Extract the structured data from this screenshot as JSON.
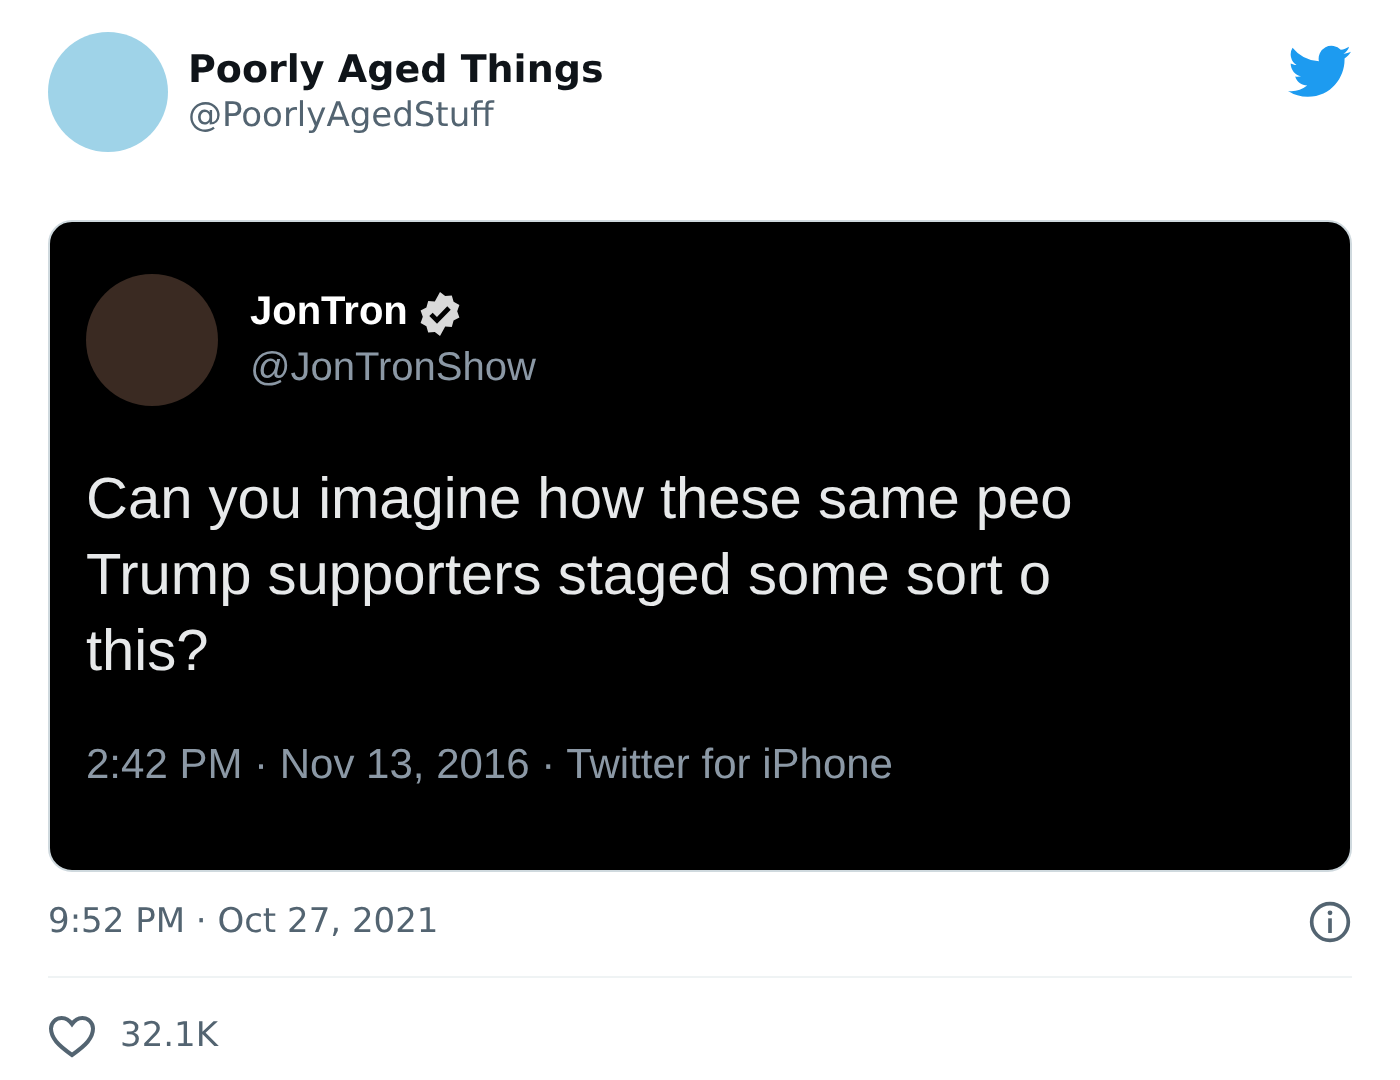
{
  "author": {
    "name": "Poorly Aged Things",
    "handle": "@PoorlyAgedStuff"
  },
  "embedded_tweet": {
    "name": "JonTron",
    "verified": true,
    "handle": "@JonTronShow",
    "lines": [
      "Can you imagine how these same peo",
      "Trump supporters staged some sort o",
      "this?"
    ],
    "meta": "2:42 PM · Nov 13, 2016 · Twitter for iPhone"
  },
  "timestamp": "9:52 PM · Oct 27, 2021",
  "likes": "32.1K"
}
